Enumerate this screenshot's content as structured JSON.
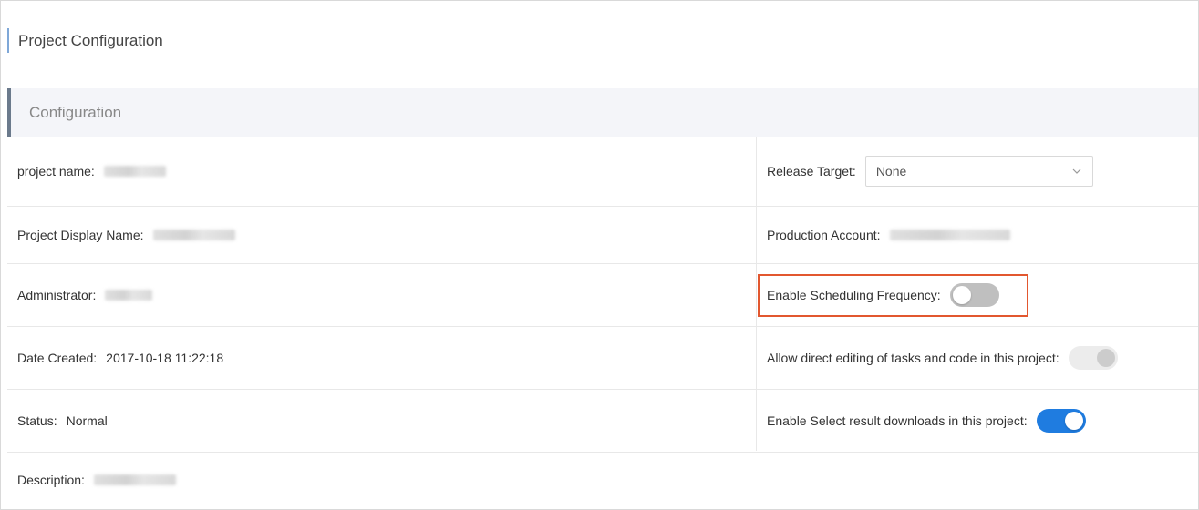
{
  "page": {
    "title": "Project Configuration"
  },
  "section": {
    "title": "Configuration"
  },
  "rows": {
    "project_name": {
      "label": "project name:"
    },
    "display_name": {
      "label": "Project Display Name:"
    },
    "administrator": {
      "label": "Administrator:"
    },
    "date_created": {
      "label": "Date Created:",
      "value": "2017-10-18 11:22:18"
    },
    "status": {
      "label": "Status:",
      "value": "Normal"
    },
    "description": {
      "label": "Description:"
    },
    "release_target": {
      "label": "Release Target:",
      "selected": "None"
    },
    "production_account": {
      "label": "Production Account:"
    },
    "scheduling_frequency": {
      "label": "Enable Scheduling Frequency:",
      "enabled": false
    },
    "direct_editing": {
      "label": "Allow direct editing of tasks and code in this project:",
      "enabled": true,
      "disabled": true
    },
    "select_downloads": {
      "label": "Enable Select result downloads in this project:",
      "enabled": true
    }
  },
  "colors": {
    "accent": "#1f7ce0",
    "highlight": "#e2572f",
    "toggle_off": "#bfbfbf"
  },
  "icons": {
    "select_arrow": "chevron-down-icon"
  }
}
